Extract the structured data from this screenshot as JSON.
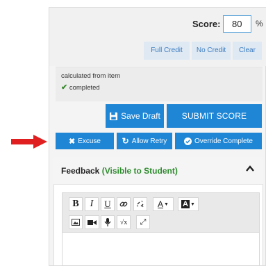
{
  "score": {
    "label": "Score:",
    "value": "80",
    "unit": "%"
  },
  "quick_buttons": {
    "full_credit": "Full Credit",
    "no_credit": "No Credit",
    "clear": "Clear"
  },
  "info": {
    "calculated": "calculated from item",
    "status": "completed"
  },
  "actions": {
    "save_draft": "Save Draft",
    "submit": "SUBMIT SCORE"
  },
  "secondary_actions": {
    "excuse": "Excuse",
    "allow_retry": "Allow Retry",
    "override_complete": "Override Complete"
  },
  "feedback": {
    "title": "Feedback",
    "visibility": "(Visible to Student)"
  },
  "toolbar": {
    "bold": "B",
    "italic": "I",
    "underline": "U"
  },
  "colors": {
    "primary": "#1f86d6",
    "annotation_arrow": "#e02020",
    "success": "#2e8b2e"
  },
  "icons": [
    "save-icon",
    "times-icon",
    "refresh-icon",
    "check-circle-icon",
    "chevron-up-icon",
    "link-icon",
    "unlink-icon",
    "font-color-icon",
    "highlight-icon",
    "image-icon",
    "video-icon",
    "microphone-icon",
    "math-icon",
    "fullscreen-icon",
    "red-arrow-icon"
  ]
}
